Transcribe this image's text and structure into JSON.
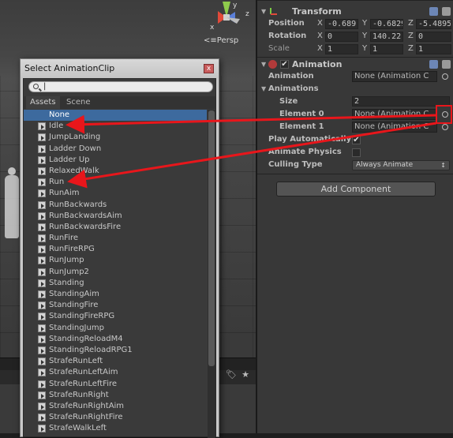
{
  "scene": {
    "persp_label": "Persp",
    "gizmo_axes": {
      "y": "y",
      "z": "z",
      "x": "x"
    }
  },
  "inspector": {
    "transform": {
      "title": "Transform",
      "position": {
        "label": "Position",
        "x": "-0.689",
        "y": "-0.6829",
        "z": "-5.4895"
      },
      "rotation": {
        "label": "Rotation",
        "x": "0",
        "y": "140.22",
        "z": "0"
      },
      "scale": {
        "label": "Scale",
        "x": "1",
        "y": "1",
        "z": "1"
      }
    },
    "animation": {
      "title": "Animation",
      "animation_label": "Animation",
      "animation_value": "None (Animation C",
      "animations_label": "Animations",
      "size_label": "Size",
      "size_value": "2",
      "element0_label": "Element 0",
      "element0_value": "None (Animation C",
      "element1_label": "Element 1",
      "element1_value": "None (Animation C",
      "play_auto_label": "Play Automatically",
      "play_auto_checked": "✔",
      "animate_physics_label": "Animate Physics",
      "culling_label": "Culling Type",
      "culling_value": "Always Animate"
    },
    "add_component": "Add Component"
  },
  "popup": {
    "title": "Select AnimationClip",
    "close": "x",
    "search_value": "|",
    "tabs": [
      "Assets",
      "Scene"
    ],
    "none_label": "None",
    "clips": [
      "Idle",
      "JumpLanding",
      "Ladder Down",
      "Ladder Up",
      "RelaxedWalk",
      "Run",
      "RunAim",
      "RunBackwards",
      "RunBackwardsAim",
      "RunBackwardsFire",
      "RunFire",
      "RunFireRPG",
      "RunJump",
      "RunJump2",
      "Standing",
      "StandingAim",
      "StandingFire",
      "StandingFireRPG",
      "StandingJump",
      "StandingReloadM4",
      "StandingReloadRPG1",
      "StrafeRunLeft",
      "StrafeRunLeftAim",
      "StrafeRunLeftFire",
      "StrafeRunRight",
      "StrafeRunRightAim",
      "StrafeRunRightFire",
      "StrafeWalkLeft"
    ]
  },
  "colors": {
    "annotation_red": "#e8161b",
    "selection_blue": "#3d6a9e"
  }
}
